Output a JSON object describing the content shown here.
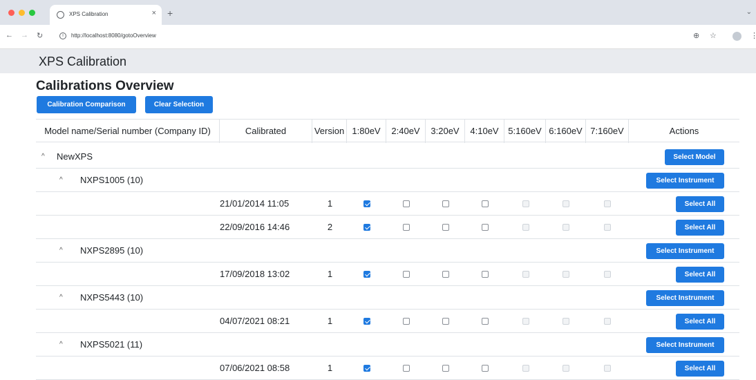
{
  "browser": {
    "tab_title": "XPS Calibration",
    "tab_close": "×",
    "new_tab": "+",
    "url": "http://localhost:8080/gotoOverview"
  },
  "app": {
    "title": "XPS Calibration",
    "page_title": "Calibrations Overview",
    "buttons": {
      "compare": "Calibration Comparison",
      "clear": "Clear Selection"
    }
  },
  "table": {
    "headers": [
      "Model name/Serial number (Company ID)",
      "Calibrated",
      "Version",
      "1:80eV",
      "2:40eV",
      "3:20eV",
      "4:10eV",
      "5:160eV",
      "6:160eV",
      "7:160eV",
      "Actions"
    ],
    "model": {
      "caret": "^",
      "name": "NewXPS",
      "button": "Select Model"
    },
    "instrument_button": "Select Instrument",
    "calibration_button": "Select All",
    "rows": [
      {
        "type": "instrument",
        "name": "NXPS1005 (10)"
      },
      {
        "type": "calibration",
        "date": "21/01/2014 11:05",
        "version": "1",
        "checks": [
          "on",
          "off",
          "off",
          "off",
          "dis",
          "dis",
          "dis"
        ]
      },
      {
        "type": "calibration",
        "date": "22/09/2016 14:46",
        "version": "2",
        "checks": [
          "on",
          "off",
          "off",
          "off",
          "dis",
          "dis",
          "dis"
        ]
      },
      {
        "type": "instrument",
        "name": "NXPS2895 (10)"
      },
      {
        "type": "calibration",
        "date": "17/09/2018 13:02",
        "version": "1",
        "checks": [
          "on",
          "off",
          "off",
          "off",
          "dis",
          "dis",
          "dis"
        ]
      },
      {
        "type": "instrument",
        "name": "NXPS5443 (10)"
      },
      {
        "type": "calibration",
        "date": "04/07/2021 08:21",
        "version": "1",
        "checks": [
          "on",
          "off",
          "off",
          "off",
          "dis",
          "dis",
          "dis"
        ]
      },
      {
        "type": "instrument",
        "name": "NXPS5021 (11)"
      },
      {
        "type": "calibration",
        "date": "07/06/2021 08:58",
        "version": "1",
        "checks": [
          "on",
          "off",
          "off",
          "off",
          "dis",
          "dis",
          "dis"
        ]
      }
    ]
  },
  "colors": {
    "primary": "#1f7ae0",
    "appbar": "#e9ebef"
  }
}
